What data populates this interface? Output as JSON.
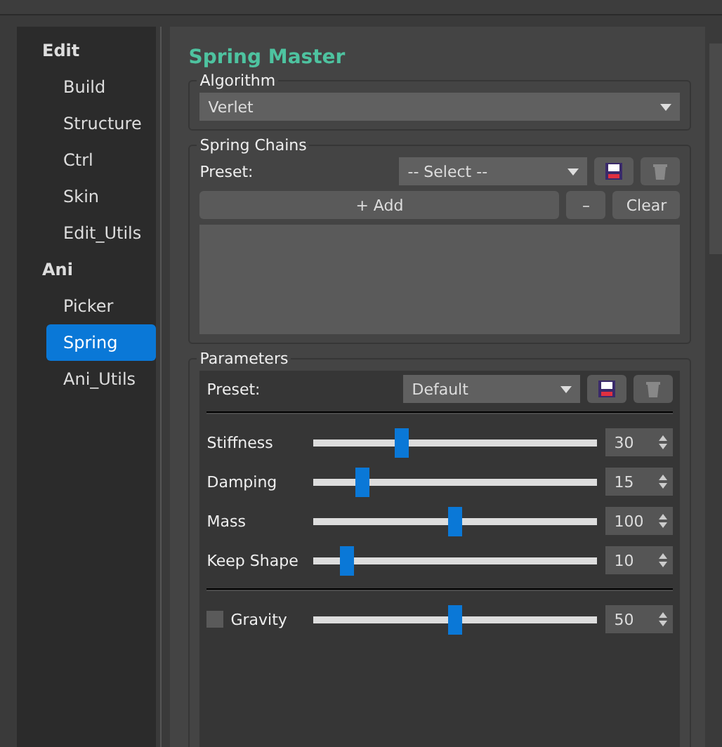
{
  "sidebar": {
    "groups": [
      {
        "label": "Edit",
        "items": [
          {
            "label": "Build",
            "selected": false
          },
          {
            "label": "Structure",
            "selected": false
          },
          {
            "label": "Ctrl",
            "selected": false
          },
          {
            "label": "Skin",
            "selected": false
          },
          {
            "label": "Edit_Utils",
            "selected": false
          }
        ]
      },
      {
        "label": "Ani",
        "items": [
          {
            "label": "Picker",
            "selected": false
          },
          {
            "label": "Spring",
            "selected": true
          },
          {
            "label": "Ani_Utils",
            "selected": false
          }
        ]
      }
    ]
  },
  "title": "Spring Master",
  "algorithm": {
    "label": "Algorithm",
    "value": "Verlet"
  },
  "spring_chains": {
    "label": "Spring Chains",
    "preset_label": "Preset:",
    "preset_value": "-- Select --",
    "add": "+ Add",
    "remove": "–",
    "clear": "Clear"
  },
  "parameters": {
    "label": "Parameters",
    "preset_label": "Preset:",
    "preset_value": "Default",
    "sliders": [
      {
        "kind": "plain",
        "name": "Stiffness",
        "level": 0.31,
        "value": "30"
      },
      {
        "kind": "plain",
        "name": "Damping",
        "level": 0.17,
        "value": "15"
      },
      {
        "kind": "plain",
        "name": "Mass",
        "level": 0.5,
        "value": "100"
      },
      {
        "kind": "plain",
        "name": "Keep Shape",
        "level": 0.12,
        "value": "10"
      },
      {
        "kind": "checkbox",
        "name": "Gravity",
        "checked": false,
        "level": 0.5,
        "value": "50"
      }
    ]
  }
}
